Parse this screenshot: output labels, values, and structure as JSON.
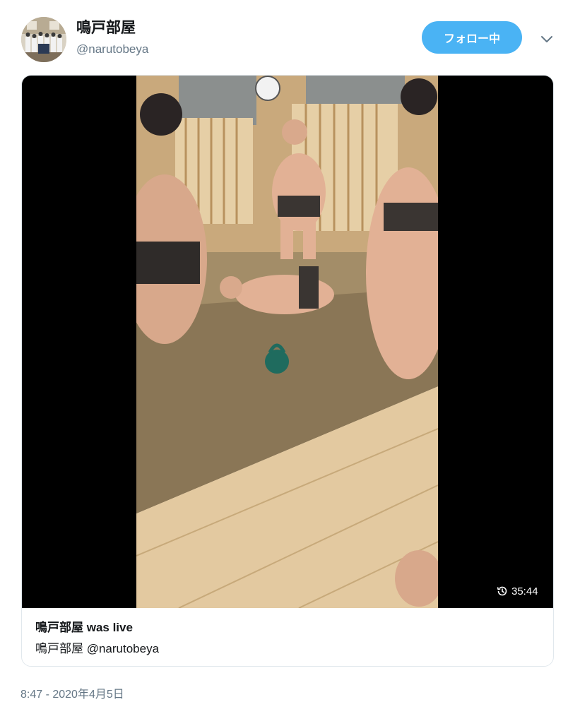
{
  "author": {
    "display_name": "鳴戸部屋",
    "handle": "@narutobeya"
  },
  "follow_button": {
    "label": "フォロー中"
  },
  "live_card": {
    "title": "鳴戸部屋 was live",
    "subtitle": "鳴戸部屋 @narutobeya",
    "duration": "35:44"
  },
  "timestamp": "8:47 - 2020年4月5日",
  "colors": {
    "accent": "#4ab3f4",
    "text_primary": "#14171a",
    "text_secondary": "#657786",
    "border": "#e1e8ed"
  },
  "icons": {
    "menu": "chevron-down-icon",
    "replay": "history-clock-icon"
  }
}
